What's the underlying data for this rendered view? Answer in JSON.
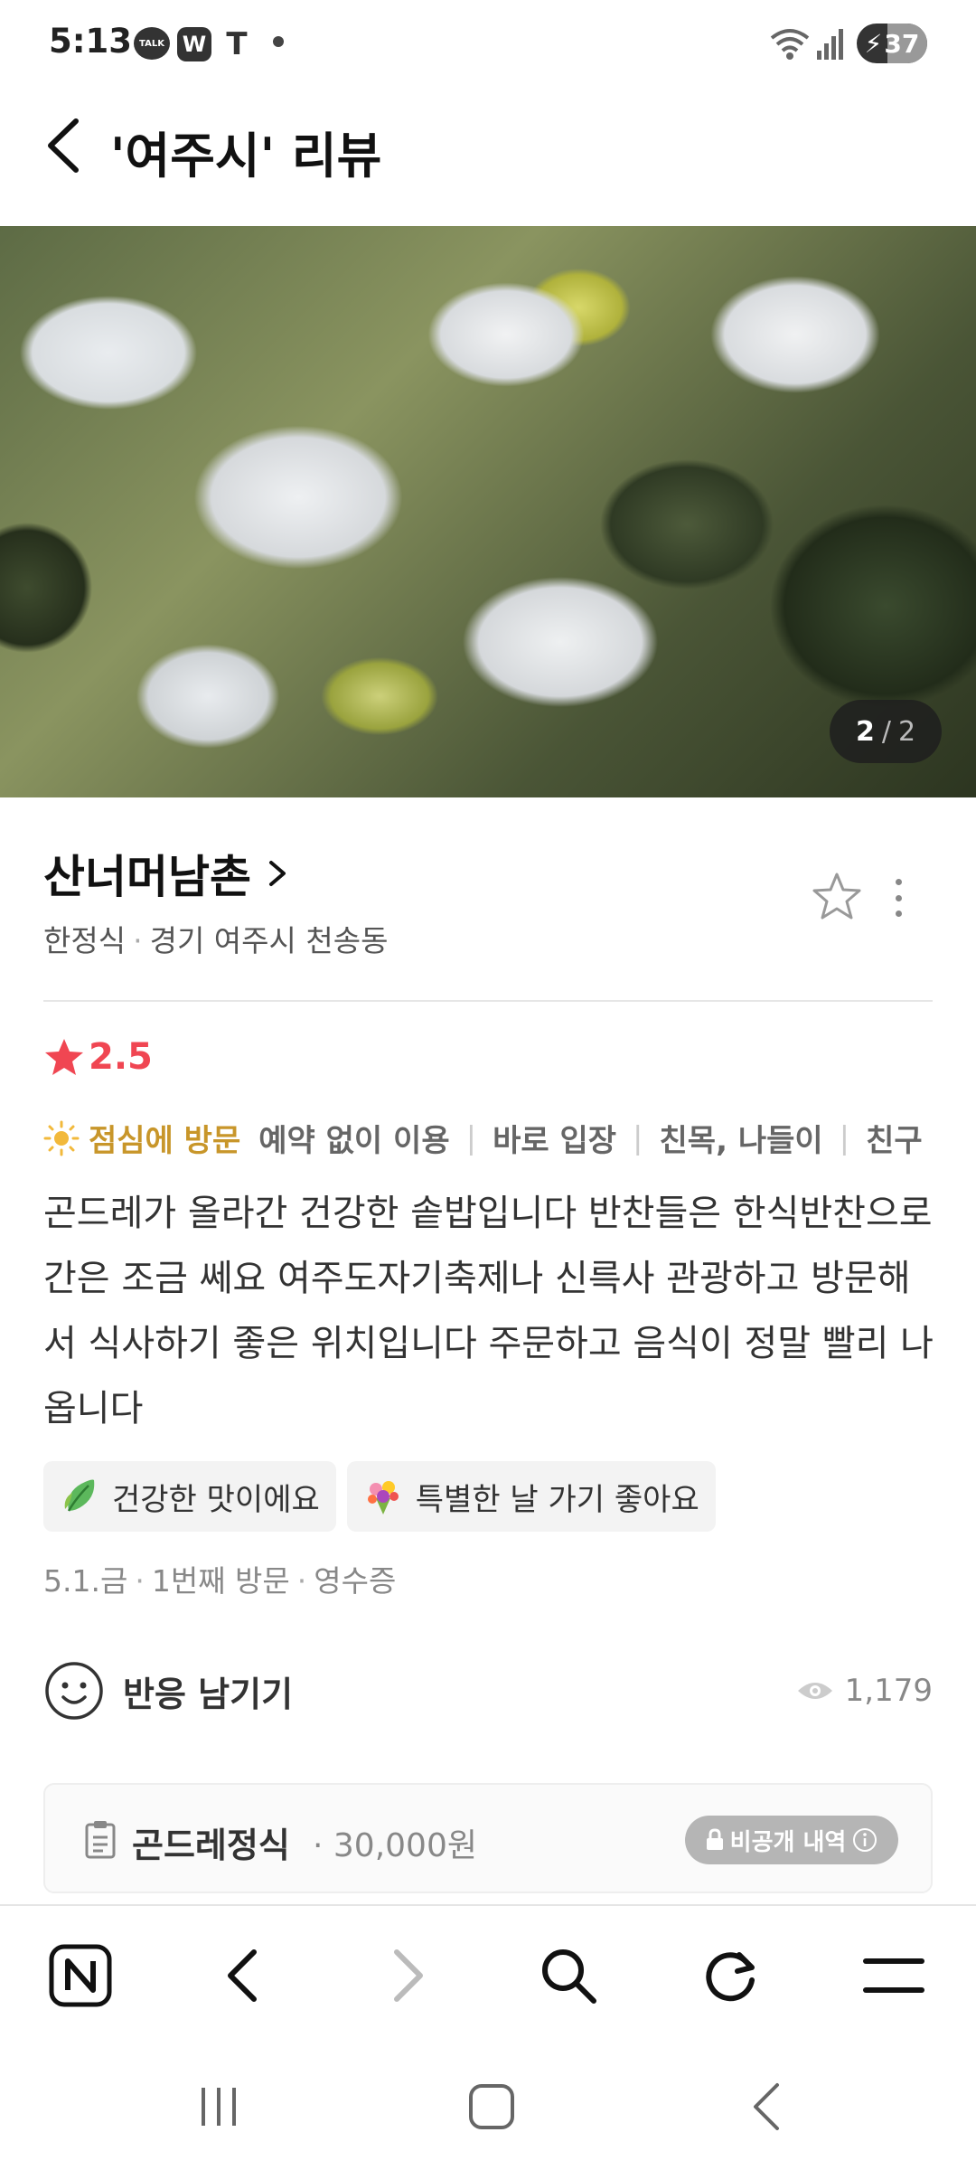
{
  "status_bar": {
    "time": "5:13",
    "battery": "37",
    "talk_label": "TALK",
    "w_label": "W",
    "t_label": "T"
  },
  "header": {
    "title": "'여주시' 리뷰"
  },
  "photo": {
    "current": "2",
    "separator": "/",
    "total": "2"
  },
  "place": {
    "name": "산너머남촌",
    "category": "한정식",
    "location": "경기 여주시 천송동"
  },
  "review": {
    "rating": "2.5",
    "visit_time": "점심에 방문",
    "visit_tags": [
      "예약 없이 이용",
      "바로 입장",
      "친목, 나들이",
      "친구"
    ],
    "text": "곤드레가 올라간 건강한 솥밥입니다 반찬들은 한식반찬으로 간은 조금 쎄요 여주도자기축제나 신륵사 관광하고 방문해서 식사하기 좋은 위치입니다 주문하고 음식이 정말 빨리 나옵니다",
    "keywords": [
      {
        "label": "건강한 맛이에요",
        "icon": "leaf-icon"
      },
      {
        "label": "특별한 날 가기 좋아요",
        "icon": "bouquet-icon"
      }
    ],
    "visit_date": "5.1.금",
    "visit_count": "1번째 방문",
    "proof": "영수증",
    "reaction_label": "반응 남기기",
    "views": "1,179"
  },
  "menu": {
    "name": "곤드레정식",
    "price": "30,000원",
    "private_label": "비공개 내역"
  },
  "colors": {
    "rating_red": "#f04652",
    "visit_gold": "#c8962a"
  }
}
